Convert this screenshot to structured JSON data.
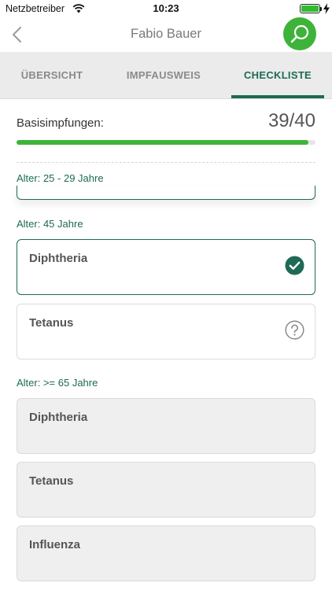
{
  "status_bar": {
    "carrier": "Netzbetreiber",
    "time": "10:23"
  },
  "nav": {
    "title": "Fabio Bauer",
    "back_icon": "chevron-left-icon",
    "search_icon": "search-icon"
  },
  "tabs": [
    {
      "label": "ÜBERSICHT",
      "active": false
    },
    {
      "label": "IMPFAUSWEIS",
      "active": false
    },
    {
      "label": "CHECKLISTE",
      "active": true
    }
  ],
  "progress": {
    "label": "Basisimpfungen:",
    "count": "39/40",
    "done": 39,
    "total": 40
  },
  "groups": [
    {
      "label": "Alter: 25 - 29 Jahre"
    },
    {
      "label": "Alter: 45 Jahre"
    },
    {
      "label": "Alter: >= 65 Jahre"
    }
  ],
  "age45_cards": [
    {
      "title": "Diphtheria",
      "status": "done",
      "icon": "check-circle-icon"
    },
    {
      "title": "Tetanus",
      "status": "open",
      "icon": "question-circle-icon"
    }
  ],
  "age65_cards": [
    {
      "title": "Diphtheria",
      "status": "future"
    },
    {
      "title": "Tetanus",
      "status": "future"
    },
    {
      "title": "Influenza",
      "status": "future"
    }
  ],
  "colors": {
    "accent": "#1e6a55",
    "progress": "#3eb33a",
    "search_button": "#3eb33a"
  }
}
